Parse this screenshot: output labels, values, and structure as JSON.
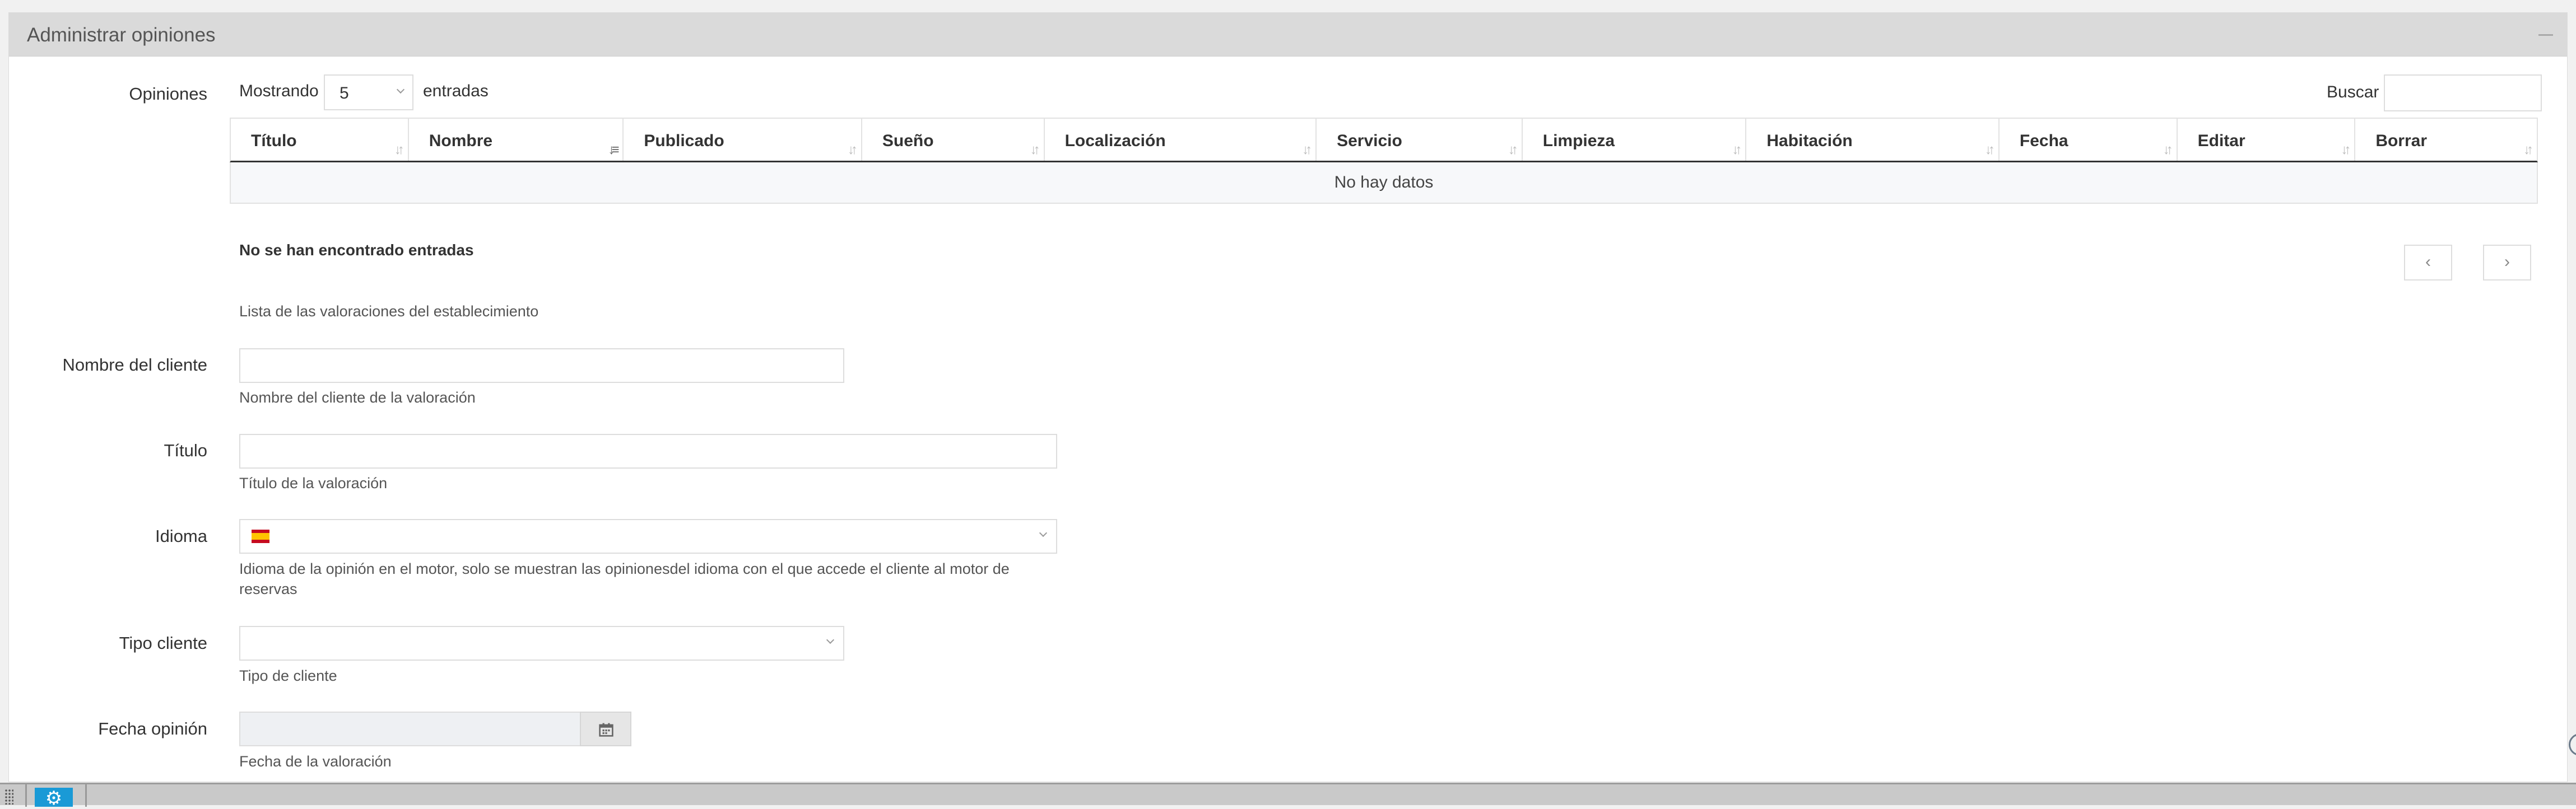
{
  "panel": {
    "title": "Administrar opiniones"
  },
  "opiniones": {
    "label": "Opiniones",
    "showing_label": "Mostrando",
    "page_size": "5",
    "entries_label": "entradas",
    "search_label": "Buscar",
    "search_value": "",
    "columns": [
      "Título",
      "Nombre",
      "Publicado",
      "Sueño",
      "Localización",
      "Servicio",
      "Limpieza",
      "Habitación",
      "Fecha",
      "Editar",
      "Borrar"
    ],
    "sorted_column": "Nombre",
    "empty_message": "No hay datos",
    "info_text": "No se han encontrado entradas",
    "prev_label": "‹",
    "next_label": "›",
    "help": "Lista de las valoraciones del establecimiento"
  },
  "form": {
    "cliente": {
      "label": "Nombre del cliente",
      "value": "",
      "help": "Nombre del cliente de la valoración"
    },
    "titulo": {
      "label": "Título",
      "value": "",
      "help": "Título de la valoración"
    },
    "idioma": {
      "label": "Idioma",
      "selected_flag": "spain-flag-icon",
      "help": "Idioma de la opinión en el motor, solo se muestran las opinionesdel idioma con el que accede el cliente al motor de reservas"
    },
    "tipo_cliente": {
      "label": "Tipo cliente",
      "value": "",
      "help": "Tipo de cliente"
    },
    "fecha": {
      "label": "Fecha opinión",
      "value": "",
      "help": "Fecha de la valoración"
    }
  },
  "taskbar": {
    "app_icon": "gear-icon"
  }
}
